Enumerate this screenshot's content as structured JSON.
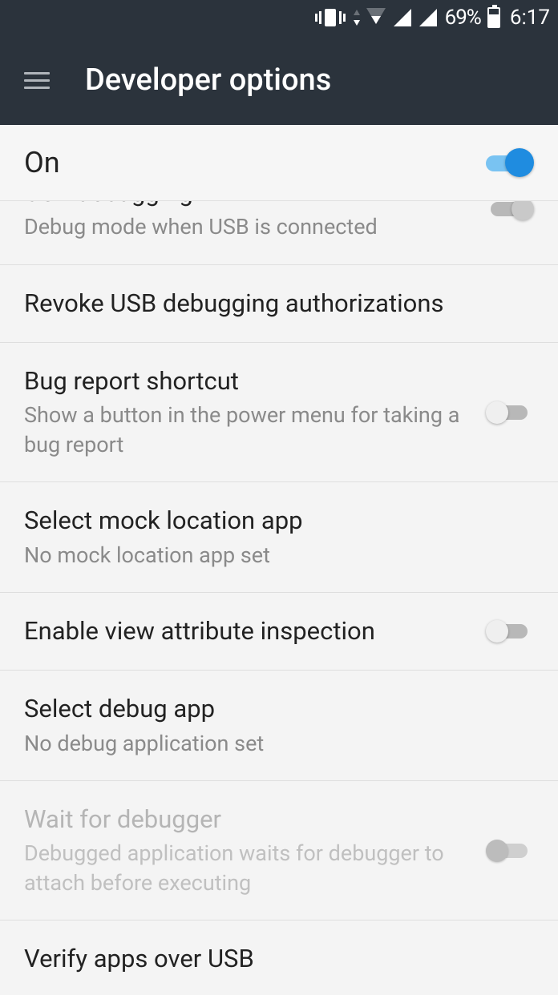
{
  "status": {
    "battery_pct": "69%",
    "time": "6:17"
  },
  "header": {
    "title": "Developer options"
  },
  "master": {
    "label": "On",
    "enabled": true
  },
  "items": [
    {
      "id": "usb-debugging",
      "title": "USB debugging",
      "subtitle": "Debug mode when USB is connected",
      "has_switch": true,
      "switch_state": "on-partial",
      "disabled": false
    },
    {
      "id": "revoke-usb",
      "title": "Revoke USB debugging authorizations",
      "subtitle": "",
      "has_switch": false,
      "disabled": false
    },
    {
      "id": "bug-report-shortcut",
      "title": "Bug report shortcut",
      "subtitle": "Show a button in the power menu for taking a bug report",
      "has_switch": true,
      "switch_state": "off",
      "disabled": false
    },
    {
      "id": "mock-location",
      "title": "Select mock location app",
      "subtitle": "No mock location app set",
      "has_switch": false,
      "disabled": false
    },
    {
      "id": "view-attr-inspect",
      "title": "Enable view attribute inspection",
      "subtitle": "",
      "has_switch": true,
      "switch_state": "off",
      "disabled": false
    },
    {
      "id": "select-debug-app",
      "title": "Select debug app",
      "subtitle": "No debug application set",
      "has_switch": false,
      "disabled": false
    },
    {
      "id": "wait-debugger",
      "title": "Wait for debugger",
      "subtitle": "Debugged application waits for debugger to attach before executing",
      "has_switch": true,
      "switch_state": "off-disabled",
      "disabled": true
    },
    {
      "id": "verify-apps-usb",
      "title": "Verify apps over USB",
      "subtitle": "",
      "has_switch": true,
      "switch_state": "off",
      "disabled": false
    }
  ]
}
